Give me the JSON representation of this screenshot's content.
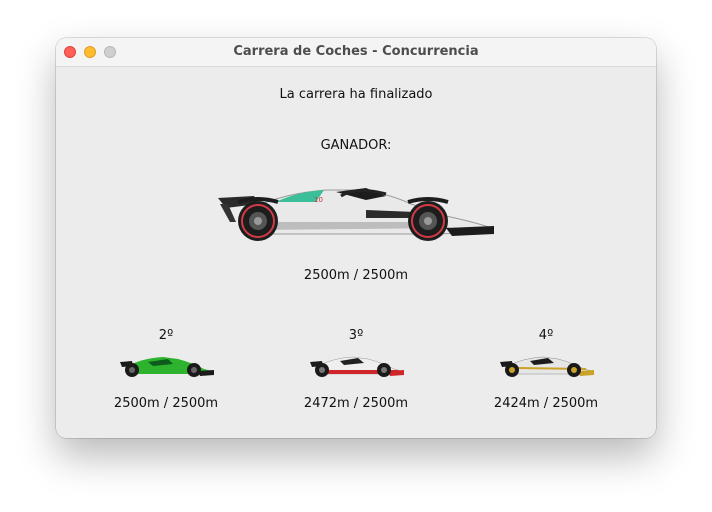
{
  "window": {
    "title": "Carrera de Coches - Concurrencia"
  },
  "race": {
    "status": "La carrera ha finalizado",
    "winner_label": "GANADOR:",
    "winner": {
      "distance": "2500m / 2500m",
      "car_icon": "f1-car-white-teal-icon"
    },
    "places": [
      {
        "position": "2º",
        "distance": "2500m / 2500m",
        "car_icon": "f1-car-green-icon",
        "color": "#2db32d"
      },
      {
        "position": "3º",
        "distance": "2472m / 2500m",
        "car_icon": "f1-car-red-white-icon",
        "color": "#d0252b"
      },
      {
        "position": "4º",
        "distance": "2424m / 2500m",
        "car_icon": "f1-car-white-gold-icon",
        "color": "#c9a227"
      }
    ]
  },
  "colors": {
    "close": "#fe5f57",
    "minimize": "#febc2e",
    "zoom": "#cfcfcf",
    "background": "#ececec"
  }
}
